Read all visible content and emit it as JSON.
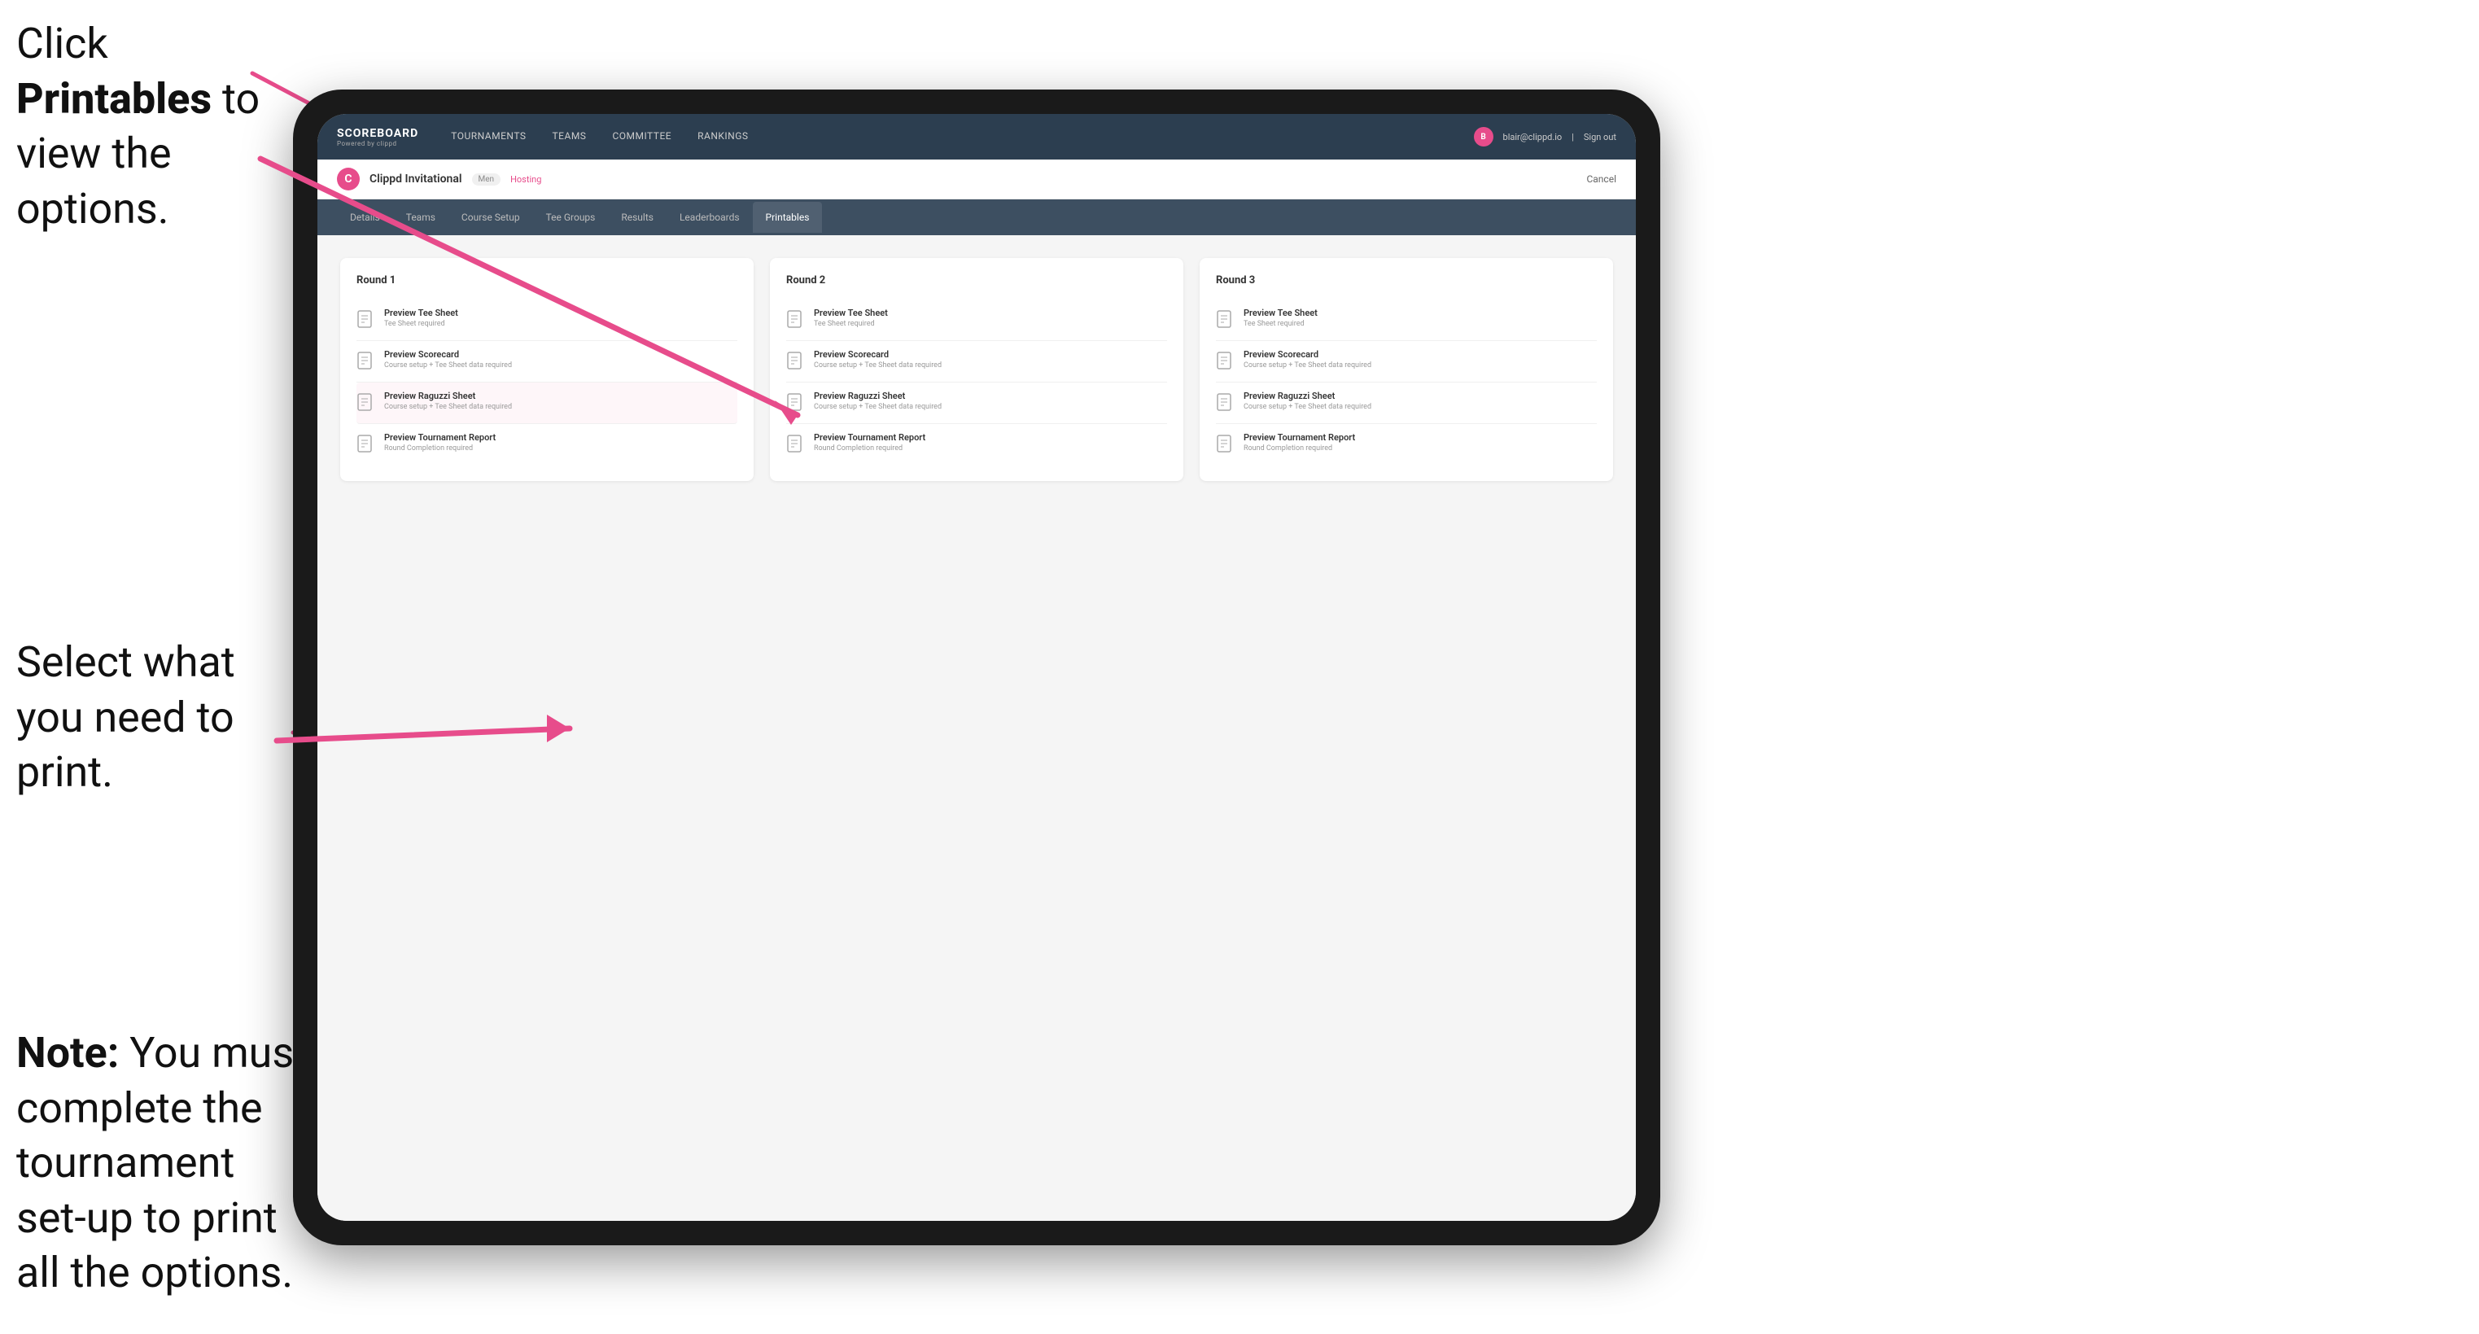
{
  "annotations": {
    "top": {
      "text_normal": "Click ",
      "text_bold": "Printables",
      "text_after": " to view the options."
    },
    "middle": {
      "text": "Select what you need to print."
    },
    "bottom": {
      "text_bold": "Note:",
      "text_after": " You must complete the tournament set-up to print all the options."
    }
  },
  "nav": {
    "logo_title": "SCOREBOARD",
    "logo_subtitle": "Powered by clippd",
    "links": [
      {
        "label": "TOURNAMENTS",
        "active": false
      },
      {
        "label": "TEAMS",
        "active": false
      },
      {
        "label": "COMMITTEE",
        "active": false
      },
      {
        "label": "RANKINGS",
        "active": false
      }
    ],
    "user_email": "blair@clippd.io",
    "sign_out": "Sign out",
    "user_initial": "B"
  },
  "tournament": {
    "name": "Clippd Invitational",
    "badge": "Men",
    "hosting": "Hosting",
    "cancel": "Cancel"
  },
  "tabs": [
    {
      "label": "Details",
      "active": false
    },
    {
      "label": "Teams",
      "active": false
    },
    {
      "label": "Course Setup",
      "active": false
    },
    {
      "label": "Tee Groups",
      "active": false
    },
    {
      "label": "Results",
      "active": false
    },
    {
      "label": "Leaderboards",
      "active": false
    },
    {
      "label": "Printables",
      "active": true
    }
  ],
  "rounds": [
    {
      "title": "Round 1",
      "items": [
        {
          "title": "Preview Tee Sheet",
          "subtitle": "Tee Sheet required"
        },
        {
          "title": "Preview Scorecard",
          "subtitle": "Course setup + Tee Sheet data required"
        },
        {
          "title": "Preview Raguzzi Sheet",
          "subtitle": "Course setup + Tee Sheet data required"
        },
        {
          "title": "Preview Tournament Report",
          "subtitle": "Round Completion required"
        }
      ]
    },
    {
      "title": "Round 2",
      "items": [
        {
          "title": "Preview Tee Sheet",
          "subtitle": "Tee Sheet required"
        },
        {
          "title": "Preview Scorecard",
          "subtitle": "Course setup + Tee Sheet data required"
        },
        {
          "title": "Preview Raguzzi Sheet",
          "subtitle": "Course setup + Tee Sheet data required"
        },
        {
          "title": "Preview Tournament Report",
          "subtitle": "Round Completion required"
        }
      ]
    },
    {
      "title": "Round 3",
      "items": [
        {
          "title": "Preview Tee Sheet",
          "subtitle": "Tee Sheet required"
        },
        {
          "title": "Preview Scorecard",
          "subtitle": "Course setup + Tee Sheet data required"
        },
        {
          "title": "Preview Raguzzi Sheet",
          "subtitle": "Course setup + Tee Sheet data required"
        },
        {
          "title": "Preview Tournament Report",
          "subtitle": "Round Completion required"
        }
      ]
    }
  ]
}
